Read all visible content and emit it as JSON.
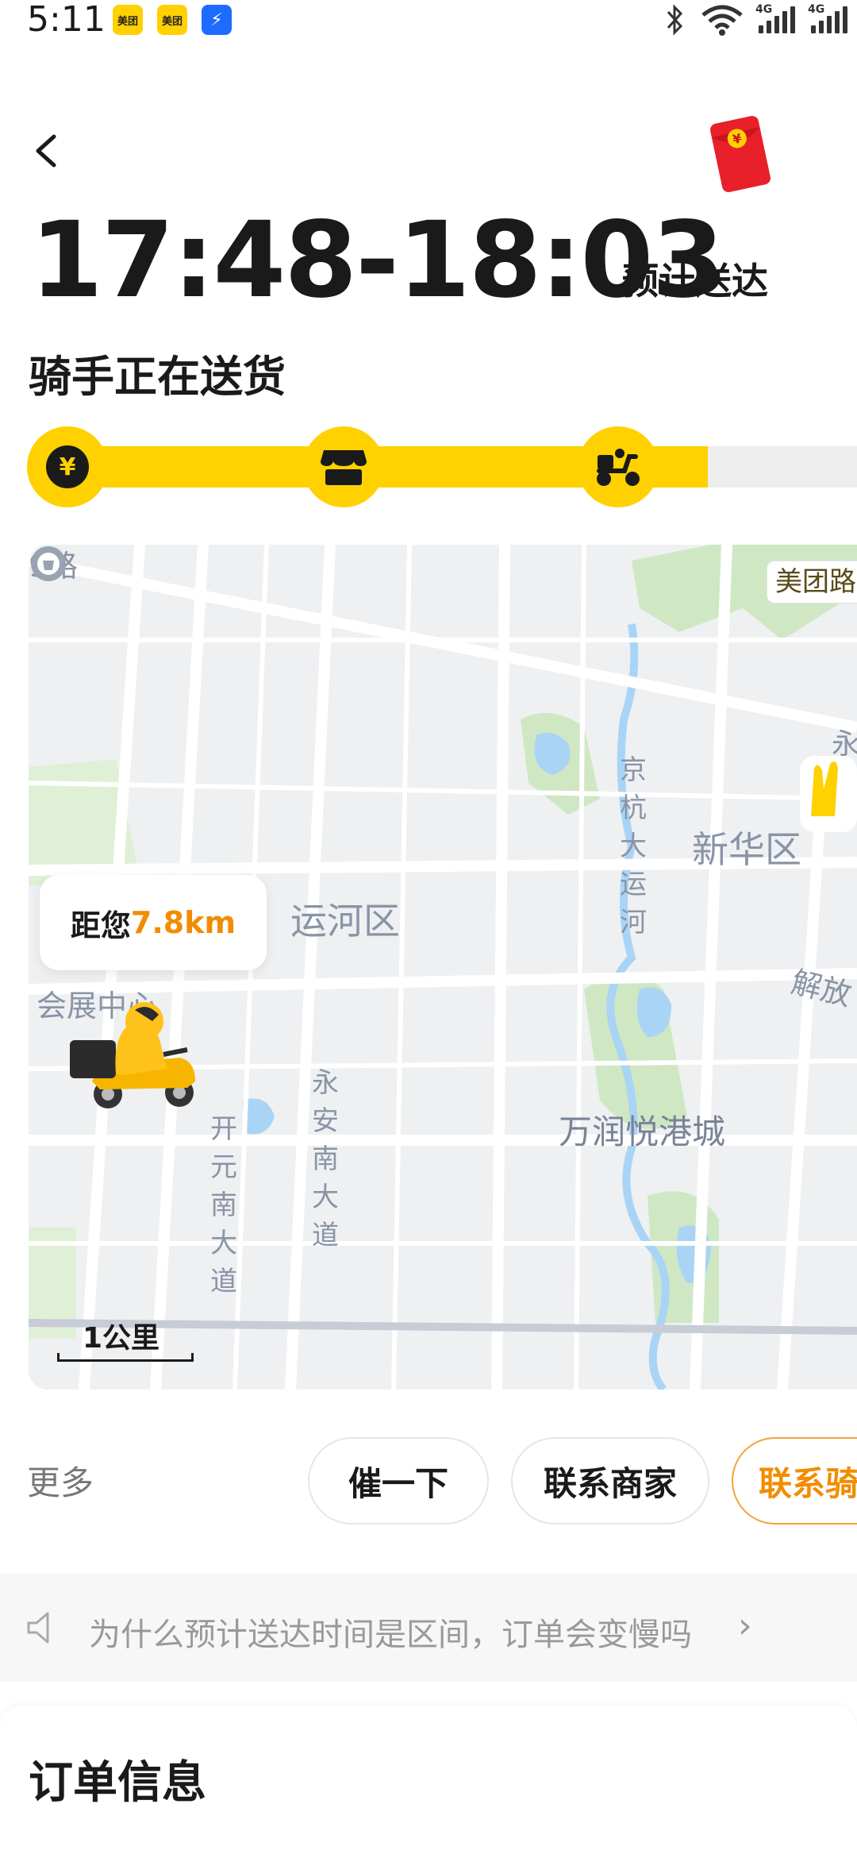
{
  "status_bar": {
    "time": "5:11",
    "app_badges": [
      "美团",
      "美团",
      "⚡"
    ],
    "icons": [
      "bluetooth-icon",
      "wifi-icon",
      "signal-4g-icon",
      "signal-4g-icon"
    ],
    "signal_label": "4G"
  },
  "header": {
    "eta_range": "17:48-18:03",
    "eta_label": "预计送达",
    "status_title": "骑手正在送货"
  },
  "progress": {
    "fraction_filled": 0.82,
    "nodes": [
      {
        "icon": "yuan-icon",
        "glyph": "¥"
      },
      {
        "icon": "store-icon",
        "glyph": ""
      },
      {
        "icon": "scooter-icon",
        "glyph": ""
      }
    ]
  },
  "map": {
    "distance_prefix": "距您",
    "distance_value": "7.8km",
    "district_label": "运河区",
    "area_label": "新华区",
    "road_labels": {
      "top_left": "9路",
      "canal": "京杭大运河",
      "yongan": "永安南大道",
      "kaiyuan": "开元南大道",
      "jiefang": "解放",
      "yong_right": "永"
    },
    "landmark_exhibition": "会展中心",
    "poi_label": "万润悦港城",
    "meituan_tag": "美团路",
    "scale_label": "1公里"
  },
  "actions": {
    "more": "更多",
    "urge": "催一下",
    "contact_merchant": "联系商家",
    "contact_rider": "联系骑"
  },
  "notice": {
    "text": "为什么预计送达时间是区间，订单会变慢吗",
    "chevron": "›"
  },
  "order": {
    "title": "订单信息"
  },
  "colors": {
    "brand_yellow": "#ffd100",
    "accent_orange": "#f28c00",
    "text_dark": "#1a1a1a"
  }
}
